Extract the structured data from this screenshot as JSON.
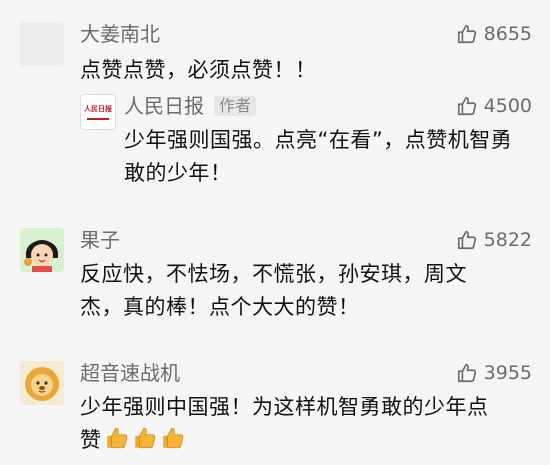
{
  "comments": [
    {
      "user": "大姜南北",
      "likes": "8655",
      "text": "点赞点赞，必须点赞！！"
    },
    {
      "user": "人民日报",
      "badge": "作者",
      "logo_text": "人民日报",
      "likes": "4500",
      "text_line1": "少年强则国强。点亮“在看”，点赞机智勇",
      "text_line2": "敢的少年！"
    },
    {
      "user": "果子",
      "likes": "5822",
      "text_line1": "反应快，不怯场，不慌张，孙安琪，周文",
      "text_line2": "杰，真的棒！点个大大的赞！"
    },
    {
      "user": "超音速战机",
      "likes": "3955",
      "text_line1": "少年强则中国强！为这样机智勇敢的少年点",
      "text_line2": "赞"
    }
  ],
  "colors": {
    "background": "#f5f5f5",
    "name": "#6b6b6b",
    "text": "#111111",
    "emoji_thumb": "#f4b43a"
  },
  "icons": {
    "like": "thumbs-up-outline-icon",
    "emoji": "thumbs-up-emoji-icon"
  }
}
